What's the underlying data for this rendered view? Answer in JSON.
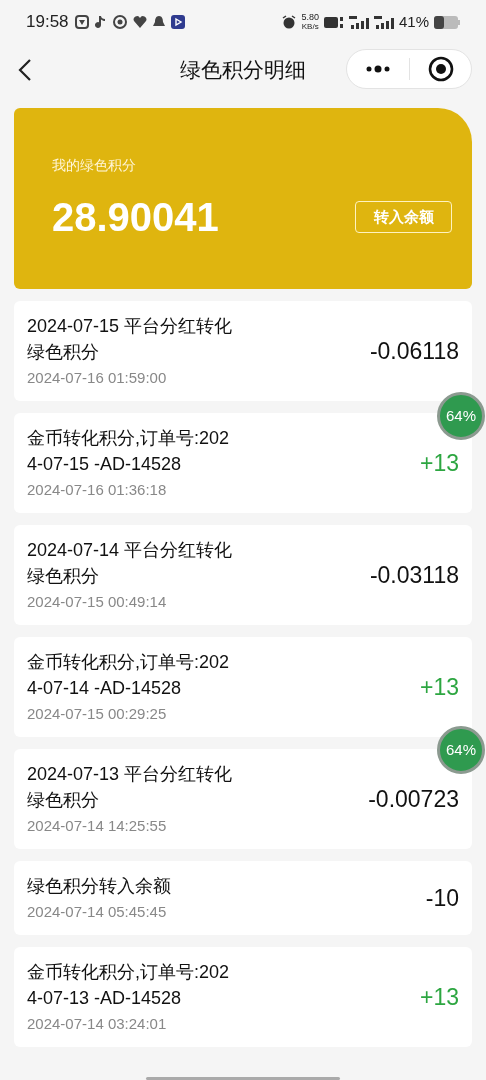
{
  "status_bar": {
    "time": "19:58",
    "net_speed": "5.80",
    "net_unit": "KB/s",
    "battery": "41%"
  },
  "nav": {
    "title": "绿色积分明细"
  },
  "summary": {
    "label": "我的绿色积分",
    "value": "28.90041",
    "button": "转入余额"
  },
  "records": [
    {
      "title": "2024-07-15 平台分红转化绿色积分",
      "time": "2024-07-16 01:59:00",
      "amount": "-0.06118",
      "kind": "debit"
    },
    {
      "title": "金币转化积分,订单号:2024-07-15 -AD-14528",
      "time": "2024-07-16 01:36:18",
      "amount": "+13",
      "kind": "credit"
    },
    {
      "title": "2024-07-14 平台分红转化绿色积分",
      "time": "2024-07-15 00:49:14",
      "amount": "-0.03118",
      "kind": "debit"
    },
    {
      "title": "金币转化积分,订单号:2024-07-14 -AD-14528",
      "time": "2024-07-15 00:29:25",
      "amount": "+13",
      "kind": "credit"
    },
    {
      "title": "2024-07-13 平台分红转化绿色积分",
      "time": "2024-07-14 14:25:55",
      "amount": "-0.00723",
      "kind": "debit"
    },
    {
      "title": "绿色积分转入余额",
      "time": "2024-07-14 05:45:45",
      "amount": "-10",
      "kind": "debit"
    },
    {
      "title": "金币转化积分,订单号:2024-07-13 -AD-14528",
      "time": "2024-07-14 03:24:01",
      "amount": "+13",
      "kind": "credit"
    }
  ],
  "floating_badges": [
    {
      "label": "64%"
    },
    {
      "label": "64%"
    }
  ]
}
